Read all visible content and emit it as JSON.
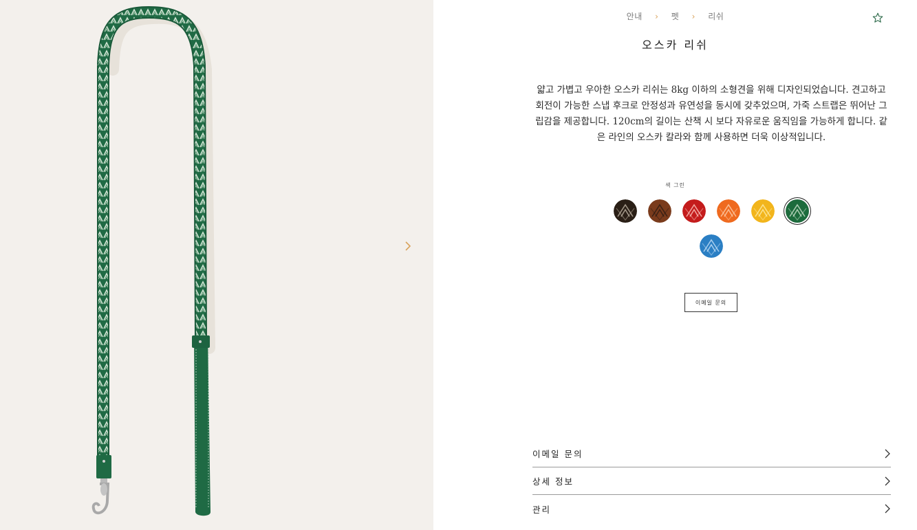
{
  "gallery": {
    "image_alt": "오스카 리쉬",
    "next_icon": "chevron-right-icon"
  },
  "breadcrumb": [
    "안내",
    "펫",
    "리쉬"
  ],
  "product": {
    "title": "오스카 리쉬",
    "description": "얇고 가볍고 우아한 오스카 리쉬는 8kg 이하의 소형견을 위해 디자인되었습니다. 견고하고 회전이 가능한 스냅 후크로 안정성과 유연성을 동시에 갖추었으며, 가죽 스트랩은 뛰어난 그립감을 제공합니다. 120cm의 길이는 산책 시 보다 자유로운 움직임을 가능하게 합니다. 같은 라인의 오스카 칼라와 함께 사용하면 더욱 이상적입니다."
  },
  "colors": {
    "label": "색 그린",
    "selected_index": 5,
    "swatches": [
      {
        "base": "#2a1f16",
        "pattern": "#c9bfae"
      },
      {
        "base": "#7a3b1c",
        "pattern": "#2a1a12"
      },
      {
        "base": "#c41c1c",
        "pattern": "#ffd0c8"
      },
      {
        "base": "#ef6a1f",
        "pattern": "#ffd7b8"
      },
      {
        "base": "#f2b51c",
        "pattern": "#fff0b0"
      },
      {
        "base": "#1c6b3c",
        "pattern": "#d8ead6"
      },
      {
        "base": "#2b7fc4",
        "pattern": "#cfe6fb"
      }
    ]
  },
  "buttons": {
    "email_inquiry": "이메일 문의"
  },
  "accordion": [
    "이메일 문의",
    "상세 정보",
    "관리"
  ],
  "icons": {
    "favorite": "star-icon",
    "chevron": "chevron-right-icon"
  },
  "theme": {
    "accent": "#d9a35c",
    "icon_green": "#2e6b4b",
    "leash_green": "#1f6a44"
  }
}
